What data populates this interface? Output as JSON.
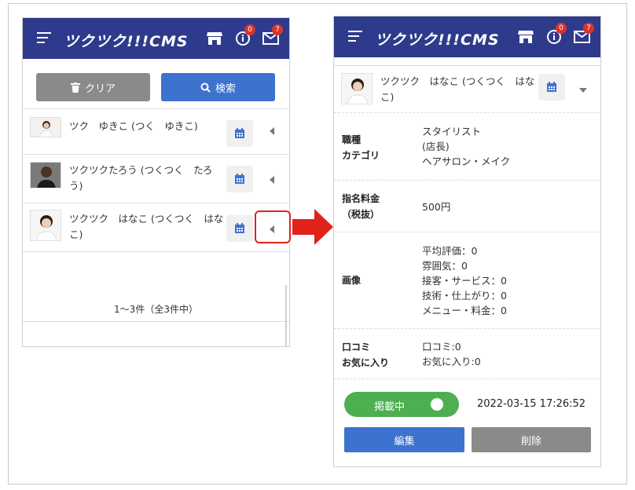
{
  "app": {
    "title": "ツクツク!!!CMS",
    "info_badge": "0",
    "mail_badge": "7"
  },
  "list_screen": {
    "clear_label": "クリア",
    "search_label": "検索",
    "rows": [
      {
        "name_line1": "ツク　ゆきこ (つく　ゆきこ)",
        "name_line2": ""
      },
      {
        "name_line1": "ツクツクたろう (つくつく　たろ",
        "name_line2": "う)"
      },
      {
        "name_line1": "ツクツク　はなこ (つくつく　はな",
        "name_line2": "こ)"
      }
    ],
    "pagination": "1〜3件（全3件中）"
  },
  "detail_screen": {
    "name_line1": "ツクツク　はなこ (つくつく　はな",
    "name_line2": "こ)",
    "job_label_1": "職種",
    "job_label_2": "カテゴリ",
    "job_values": [
      "スタイリスト",
      "(店長)",
      "ヘアサロン・メイク"
    ],
    "fee_label_1": "指名料金",
    "fee_label_2": "（税抜）",
    "fee_value": "500円",
    "image_label": "画像",
    "image_values": [
      "平均評価：0",
      "雰囲気：0",
      "接客・サービス：0",
      "技術・仕上がり：0",
      "メニュー・料金：0"
    ],
    "review_label_1": "口コミ",
    "review_label_2": "お気に入り",
    "review_values": [
      "口コミ:0",
      "お気に入り:0"
    ],
    "toggle_label": "掲載中",
    "timestamp": "2022-03-15 17:26:52",
    "edit_label": "編集",
    "delete_label": "削除"
  },
  "colors": {
    "header": "#2e3a8c",
    "primary": "#3e72cf",
    "gray_button": "#8a8a8a",
    "toggle_on": "#4caf50",
    "highlight": "#e0231a"
  }
}
